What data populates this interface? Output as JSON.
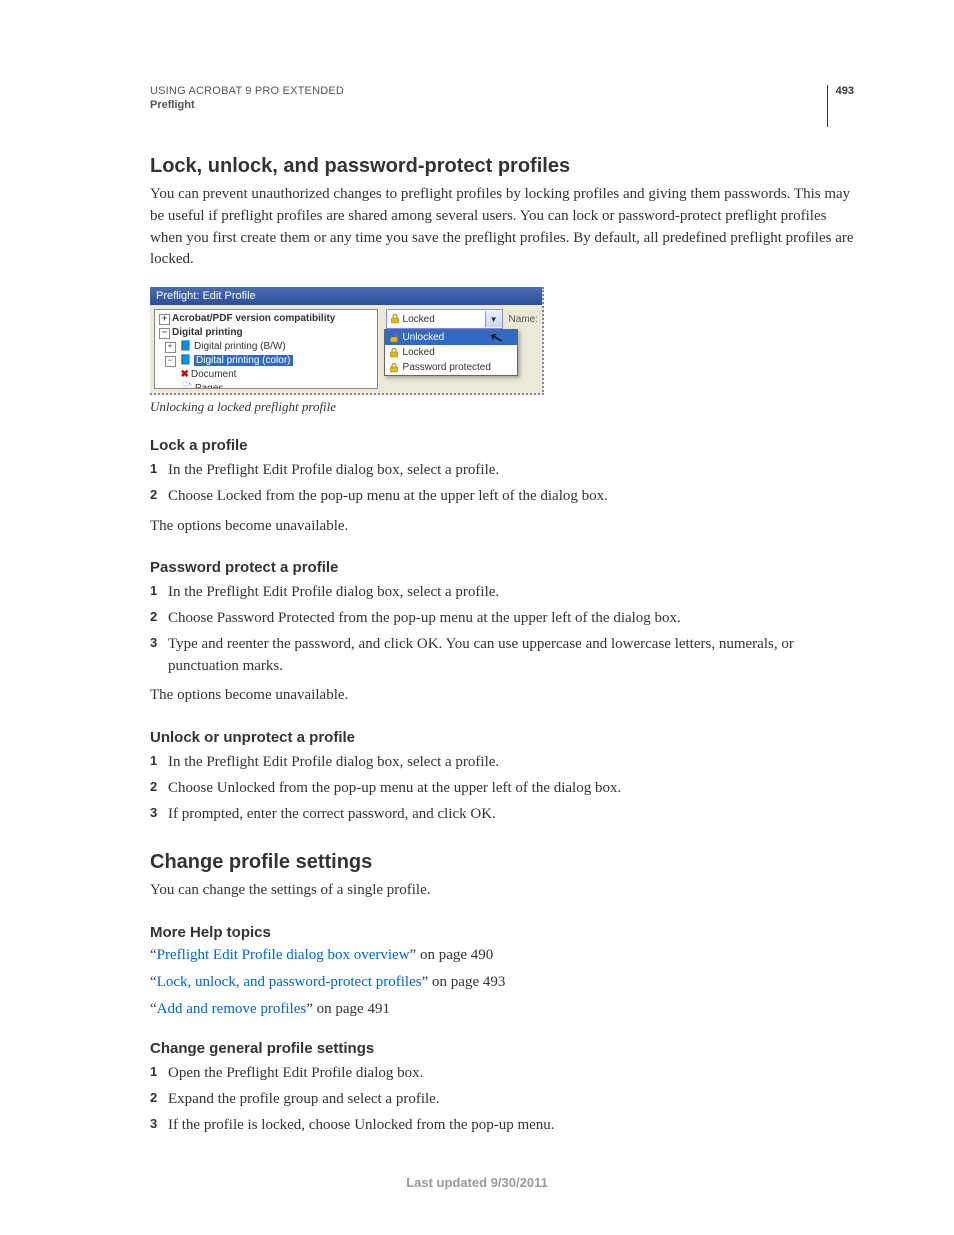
{
  "header": {
    "product": "USING ACROBAT 9 PRO EXTENDED",
    "section": "Preflight",
    "page_number": "493"
  },
  "section1": {
    "heading": "Lock, unlock, and password-protect profiles",
    "para": "You can prevent unauthorized changes to preflight profiles by locking profiles and giving them passwords. This may be useful if preflight profiles are shared among several users. You can lock or password-protect preflight profiles when you first create them or any time you save the preflight profiles. By default, all predefined preflight profiles are locked."
  },
  "figure": {
    "window_title": "Preflight: Edit Profile",
    "tree": {
      "node0": "Acrobat/PDF version compatibility",
      "node1": "Digital printing",
      "node2": "Digital printing (B/W)",
      "node3": "Digital printing (color)",
      "node4": "Document",
      "node5": "Pages"
    },
    "dropdown": {
      "selected": "Locked",
      "name_label": "Name:",
      "item0": "Unlocked",
      "item1": "Locked",
      "item2": "Password protected"
    },
    "caption": "Unlocking a locked preflight profile"
  },
  "lock_profile": {
    "heading": "Lock a profile",
    "step1": "In the Preflight Edit Profile dialog box, select a profile.",
    "step2": "Choose Locked from the pop-up menu at the upper left of the dialog box.",
    "after": "The options become unavailable."
  },
  "password_protect": {
    "heading": "Password protect a profile",
    "step1": "In the Preflight Edit Profile dialog box, select a profile.",
    "step2": "Choose Password Protected from the pop-up menu at the upper left of the dialog box.",
    "step3": "Type and reenter the password, and click OK. You can use uppercase and lowercase letters, numerals, or punctuation marks.",
    "after": "The options become unavailable."
  },
  "unlock": {
    "heading": "Unlock or unprotect a profile",
    "step1": "In the Preflight Edit Profile dialog box, select a profile.",
    "step2": "Choose Unlocked from the pop-up menu at the upper left of the dialog box.",
    "step3": "If prompted, enter the correct password, and click OK."
  },
  "section2": {
    "heading": "Change profile settings",
    "para": "You can change the settings of a single profile."
  },
  "more_help": {
    "heading": "More Help topics",
    "l1_text": "Preflight Edit Profile dialog box overview",
    "l1_suffix": " on page 490",
    "l2_text": "Lock, unlock, and password-protect profiles",
    "l2_suffix": " on page 493",
    "l3_text": "Add and remove profiles",
    "l3_suffix": " on page 491"
  },
  "change_general": {
    "heading": "Change general profile settings",
    "step1": "Open the Preflight Edit Profile dialog box.",
    "step2": "Expand the profile group and select a profile.",
    "step3": "If the profile is locked, choose Unlocked from the pop-up menu."
  },
  "footer": "Last updated 9/30/2011"
}
